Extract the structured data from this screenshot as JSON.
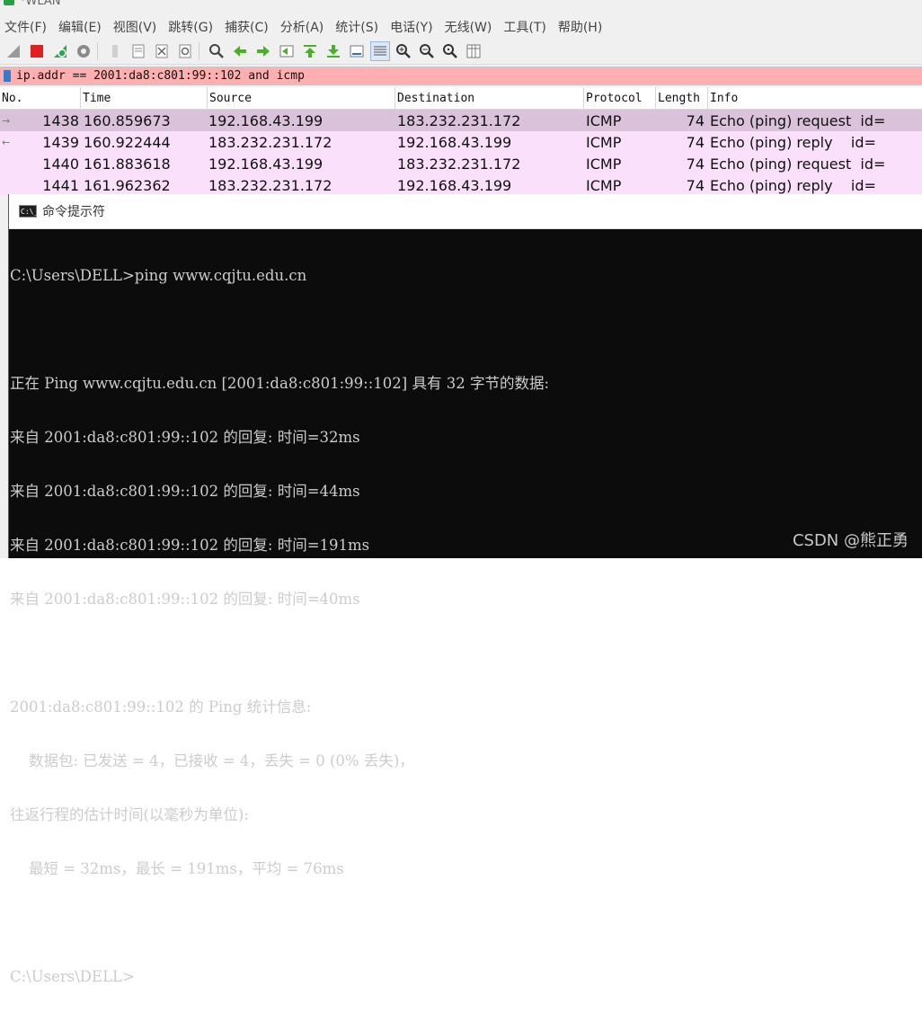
{
  "window": {
    "title": "*WLAN"
  },
  "menu": [
    "文件(F)",
    "编辑(E)",
    "视图(V)",
    "跳转(G)",
    "捕获(C)",
    "分析(A)",
    "统计(S)",
    "电话(Y)",
    "无线(W)",
    "工具(T)",
    "帮助(H)"
  ],
  "toolbar_icons": [
    "shark-fin-icon",
    "stop-capture-icon",
    "restart-capture-icon",
    "capture-options-icon",
    "open-file-icon",
    "save-file-icon",
    "close-file-icon",
    "reload-file-icon",
    "find-packet-icon",
    "go-back-icon",
    "go-forward-icon",
    "go-to-packet-icon",
    "first-packet-icon",
    "last-packet-icon",
    "autoscroll-icon",
    "colorize-icon",
    "zoom-in-icon",
    "zoom-out-icon",
    "normal-size-icon",
    "resize-columns-icon"
  ],
  "filter": {
    "text": "ip.addr == 2001:da8:c801:99::102 and icmp"
  },
  "packet_list": {
    "columns": [
      "No.",
      "Time",
      "Source",
      "Destination",
      "Protocol",
      "Length",
      "Info"
    ],
    "rows": [
      {
        "no": "1438",
        "time": "160.859673",
        "src": "192.168.43.199",
        "dst": "183.232.231.172",
        "proto": "ICMP",
        "len": "74",
        "info": "Echo (ping) request  id="
      },
      {
        "no": "1439",
        "time": "160.922444",
        "src": "183.232.231.172",
        "dst": "192.168.43.199",
        "proto": "ICMP",
        "len": "74",
        "info": "Echo (ping) reply    id="
      },
      {
        "no": "1440",
        "time": "161.883618",
        "src": "192.168.43.199",
        "dst": "183.232.231.172",
        "proto": "ICMP",
        "len": "74",
        "info": "Echo (ping) request  id="
      },
      {
        "no": "1441",
        "time": "161.962362",
        "src": "183.232.231.172",
        "dst": "192.168.43.199",
        "proto": "ICMP",
        "len": "74",
        "info": "Echo (ping) reply    id="
      }
    ]
  },
  "cmd": {
    "title": "命令提示符",
    "lines": [
      "C:\\Users\\DELL>ping www.cqjtu.edu.cn",
      "",
      "正在 Ping www.cqjtu.edu.cn [2001:da8:c801:99::102] 具有 32 字节的数据:",
      "来自 2001:da8:c801:99::102 的回复: 时间=32ms",
      "来自 2001:da8:c801:99::102 的回复: 时间=44ms",
      "来自 2001:da8:c801:99::102 的回复: 时间=191ms",
      "来自 2001:da8:c801:99::102 的回复: 时间=40ms",
      "",
      "2001:da8:c801:99::102 的 Ping 统计信息:",
      "    数据包: 已发送 = 4，已接收 = 4，丢失 = 0 (0% 丢失)，",
      "往返行程的估计时间(以毫秒为单位):",
      "    最短 = 32ms，最长 = 191ms，平均 = 76ms",
      "",
      "C:\\Users\\DELL>"
    ]
  },
  "watermark": "CSDN @熊正勇"
}
